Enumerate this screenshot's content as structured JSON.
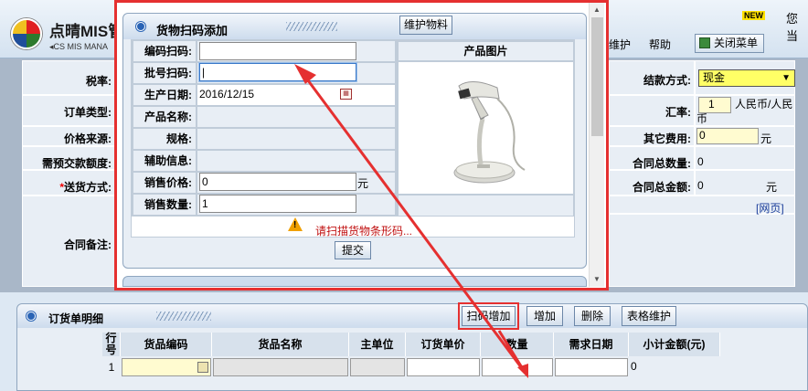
{
  "header": {
    "app_title": "点晴MIS管",
    "app_subtitle": "CS MIS MANA",
    "new_badge": "NEW",
    "user_text": "您当",
    "menu_items": [
      "维护",
      "帮助"
    ],
    "close_menu": "关闭菜单"
  },
  "order_form": {
    "tax_rate_label": "税率:",
    "order_type_label": "订单类型:",
    "price_source_label": "价格来源:",
    "prepay_label": "需预交款额度:",
    "required_mark": "*",
    "delivery_label": "送货方式:",
    "remark_label": "合同备注:",
    "payment_label": "结款方式:",
    "payment_value": "现金",
    "exchange_label": "汇率:",
    "exchange_value": "1",
    "exchange_unit": "人民币/人民币",
    "other_fee_label": "其它费用:",
    "other_fee_value": "0",
    "other_fee_unit": "元",
    "total_qty_label": "合同总数量:",
    "total_qty_value": "0",
    "total_amount_label": "合同总金额:",
    "total_amount_value": "0",
    "total_amount_unit": "元",
    "web_link": "[网页]"
  },
  "dialog": {
    "title": "货物扫码添加",
    "maintain_button": "维护物料",
    "fields": [
      {
        "label": "编码扫码:",
        "value": ""
      },
      {
        "label": "批号扫码:",
        "value": "|"
      },
      {
        "label": "生产日期:",
        "value": "2016/12/15"
      },
      {
        "label": "产品名称:",
        "value": ""
      },
      {
        "label": "规格:",
        "value": ""
      },
      {
        "label": "辅助信息:",
        "value": ""
      },
      {
        "label": "销售价格:",
        "value": "0",
        "unit": "元"
      },
      {
        "label": "销售数量:",
        "value": "1"
      }
    ],
    "image_header": "产品图片",
    "warning_text": "请扫描货物条形码...",
    "submit_button": "提交"
  },
  "detail": {
    "title": "订货单明细",
    "buttons": [
      "扫码增加",
      "增加",
      "删除",
      "表格维护"
    ],
    "columns": [
      "行号",
      "货品编码",
      "货品名称",
      "主单位",
      "订货单价",
      "数量",
      "需求日期",
      "小计金额(元)"
    ],
    "rows": [
      {
        "no": "1",
        "code": "",
        "name": "",
        "unit": "",
        "price": "",
        "qty": "",
        "date": "",
        "subtotal": "0"
      }
    ]
  },
  "colors": {
    "highlight_red": "#e53030",
    "panel_bg": "#e8eef5",
    "input_yellow": "#fffbd0",
    "select_yellow": "#ffff66",
    "warning_red": "#c01010"
  }
}
